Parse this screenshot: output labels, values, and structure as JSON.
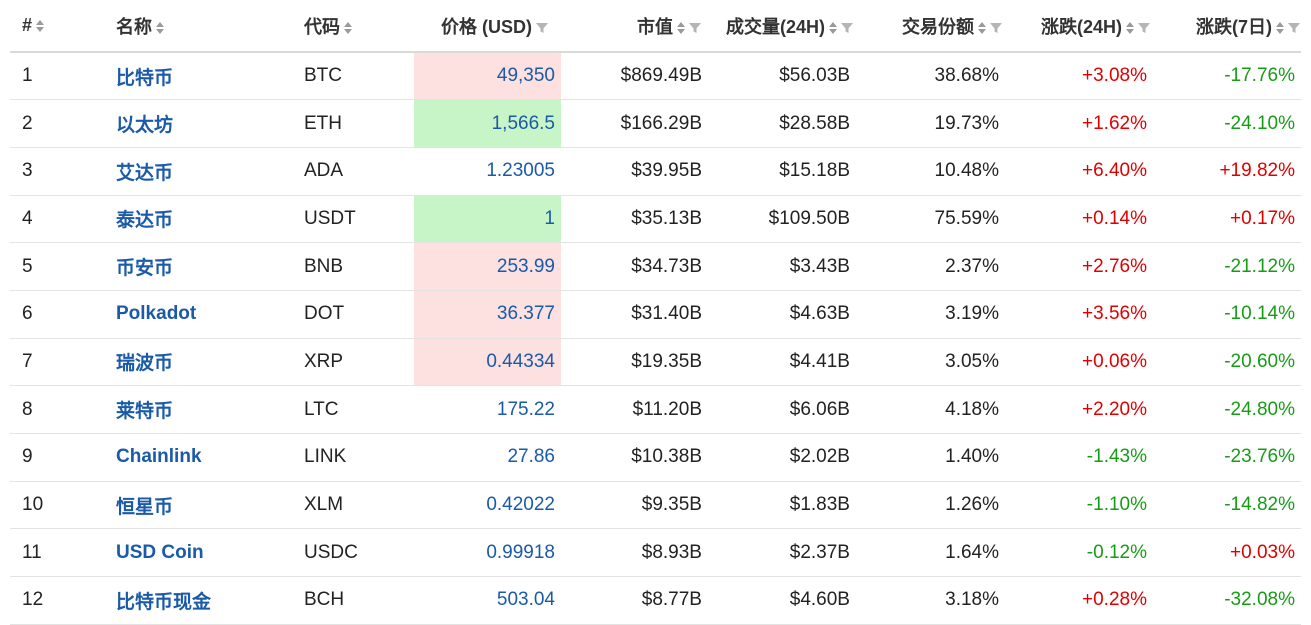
{
  "header": {
    "rank": "#",
    "name": "名称",
    "symbol": "代码",
    "price": "价格 (USD)",
    "market_cap": "市值",
    "volume": "成交量(24H)",
    "share": "交易份额",
    "change_24h": "涨跌(24H)",
    "change_7d": "涨跌(7日)"
  },
  "colors": {
    "link": "#1a5aa8",
    "up": "#e00000",
    "down": "#169c16",
    "flash_up": "#fde0e0",
    "flash_down": "#c8f5c8"
  },
  "rows": [
    {
      "rank": "1",
      "name": "比特币",
      "symbol": "BTC",
      "price": "49,350",
      "flash": "up",
      "market_cap": "$869.49B",
      "volume": "$56.03B",
      "share": "38.68%",
      "change_24h": "+3.08%",
      "change_7d": "-17.76%"
    },
    {
      "rank": "2",
      "name": "以太坊",
      "symbol": "ETH",
      "price": "1,566.5",
      "flash": "down",
      "market_cap": "$166.29B",
      "volume": "$28.58B",
      "share": "19.73%",
      "change_24h": "+1.62%",
      "change_7d": "-24.10%"
    },
    {
      "rank": "3",
      "name": "艾达币",
      "symbol": "ADA",
      "price": "1.23005",
      "flash": "",
      "market_cap": "$39.95B",
      "volume": "$15.18B",
      "share": "10.48%",
      "change_24h": "+6.40%",
      "change_7d": "+19.82%"
    },
    {
      "rank": "4",
      "name": "泰达币",
      "symbol": "USDT",
      "price": "1",
      "flash": "down",
      "market_cap": "$35.13B",
      "volume": "$109.50B",
      "share": "75.59%",
      "change_24h": "+0.14%",
      "change_7d": "+0.17%"
    },
    {
      "rank": "5",
      "name": "币安币",
      "symbol": "BNB",
      "price": "253.99",
      "flash": "up",
      "market_cap": "$34.73B",
      "volume": "$3.43B",
      "share": "2.37%",
      "change_24h": "+2.76%",
      "change_7d": "-21.12%"
    },
    {
      "rank": "6",
      "name": "Polkadot",
      "symbol": "DOT",
      "price": "36.377",
      "flash": "up",
      "market_cap": "$31.40B",
      "volume": "$4.63B",
      "share": "3.19%",
      "change_24h": "+3.56%",
      "change_7d": "-10.14%"
    },
    {
      "rank": "7",
      "name": "瑞波币",
      "symbol": "XRP",
      "price": "0.44334",
      "flash": "up",
      "market_cap": "$19.35B",
      "volume": "$4.41B",
      "share": "3.05%",
      "change_24h": "+0.06%",
      "change_7d": "-20.60%"
    },
    {
      "rank": "8",
      "name": "莱特币",
      "symbol": "LTC",
      "price": "175.22",
      "flash": "",
      "market_cap": "$11.20B",
      "volume": "$6.06B",
      "share": "4.18%",
      "change_24h": "+2.20%",
      "change_7d": "-24.80%"
    },
    {
      "rank": "9",
      "name": "Chainlink",
      "symbol": "LINK",
      "price": "27.86",
      "flash": "",
      "market_cap": "$10.38B",
      "volume": "$2.02B",
      "share": "1.40%",
      "change_24h": "-1.43%",
      "change_7d": "-23.76%"
    },
    {
      "rank": "10",
      "name": "恒星币",
      "symbol": "XLM",
      "price": "0.42022",
      "flash": "",
      "market_cap": "$9.35B",
      "volume": "$1.83B",
      "share": "1.26%",
      "change_24h": "-1.10%",
      "change_7d": "-14.82%"
    },
    {
      "rank": "11",
      "name": "USD Coin",
      "symbol": "USDC",
      "price": "0.99918",
      "flash": "",
      "market_cap": "$8.93B",
      "volume": "$2.37B",
      "share": "1.64%",
      "change_24h": "-0.12%",
      "change_7d": "+0.03%"
    },
    {
      "rank": "12",
      "name": "比特币现金",
      "symbol": "BCH",
      "price": "503.04",
      "flash": "",
      "market_cap": "$8.77B",
      "volume": "$4.60B",
      "share": "3.18%",
      "change_24h": "+0.28%",
      "change_7d": "-32.08%"
    }
  ]
}
